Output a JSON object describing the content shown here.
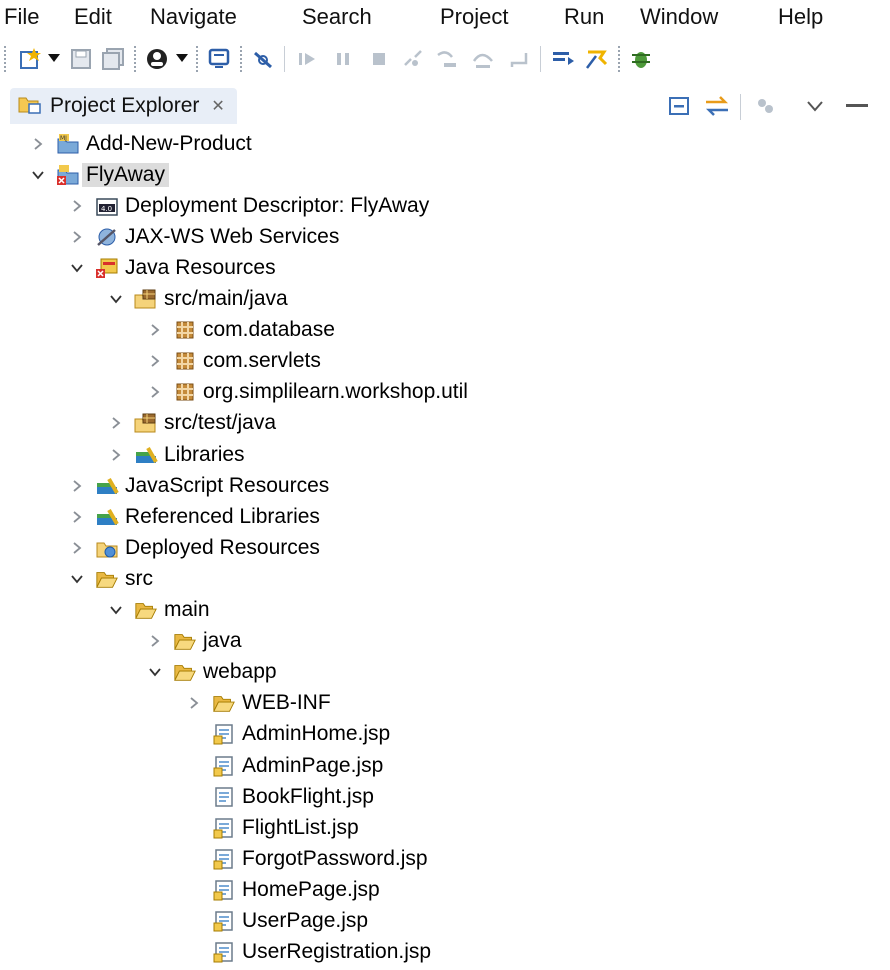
{
  "menu": [
    "File",
    "Edit",
    "Navigate",
    "Search",
    "Project",
    "Run",
    "Window",
    "Help"
  ],
  "explorer": {
    "title": "Project Explorer",
    "close_glyph": "✕"
  },
  "tree": [
    {
      "label": "Add-New-Product",
      "depth": 0,
      "state": "collapsed",
      "icon": "project-icon"
    },
    {
      "label": "FlyAway",
      "depth": 0,
      "state": "expanded",
      "icon": "project-error-icon",
      "selected": true
    },
    {
      "label": "Deployment Descriptor: FlyAway",
      "depth": 1,
      "state": "collapsed",
      "icon": "deployment-descriptor-icon"
    },
    {
      "label": "JAX-WS Web Services",
      "depth": 1,
      "state": "collapsed",
      "icon": "web-services-icon"
    },
    {
      "label": "Java Resources",
      "depth": 1,
      "state": "expanded",
      "icon": "java-resources-error-icon"
    },
    {
      "label": "src/main/java",
      "depth": 2,
      "state": "expanded",
      "icon": "source-folder-icon"
    },
    {
      "label": "com.database",
      "depth": 3,
      "state": "collapsed",
      "icon": "package-icon"
    },
    {
      "label": "com.servlets",
      "depth": 3,
      "state": "collapsed",
      "icon": "package-icon"
    },
    {
      "label": "org.simplilearn.workshop.util",
      "depth": 3,
      "state": "collapsed",
      "icon": "package-icon"
    },
    {
      "label": "src/test/java",
      "depth": 2,
      "state": "collapsed",
      "icon": "source-folder-icon"
    },
    {
      "label": "Libraries",
      "depth": 2,
      "state": "collapsed",
      "icon": "libraries-icon"
    },
    {
      "label": "JavaScript Resources",
      "depth": 1,
      "state": "collapsed",
      "icon": "libraries-icon"
    },
    {
      "label": "Referenced Libraries",
      "depth": 1,
      "state": "collapsed",
      "icon": "libraries-icon"
    },
    {
      "label": "Deployed Resources",
      "depth": 1,
      "state": "collapsed",
      "icon": "deployed-resources-icon"
    },
    {
      "label": "src",
      "depth": 1,
      "state": "expanded",
      "icon": "open-folder-icon"
    },
    {
      "label": "main",
      "depth": 2,
      "state": "expanded",
      "icon": "open-folder-icon"
    },
    {
      "label": "java",
      "depth": 3,
      "state": "collapsed",
      "icon": "folder-icon"
    },
    {
      "label": "webapp",
      "depth": 3,
      "state": "expanded",
      "icon": "open-folder-icon"
    },
    {
      "label": "WEB-INF",
      "depth": 4,
      "state": "collapsed",
      "icon": "folder-icon"
    },
    {
      "label": "AdminHome.jsp",
      "depth": 4,
      "state": "leaf",
      "icon": "jsp-file-icon"
    },
    {
      "label": "AdminPage.jsp",
      "depth": 4,
      "state": "leaf",
      "icon": "jsp-file-icon"
    },
    {
      "label": "BookFlight.jsp",
      "depth": 4,
      "state": "leaf",
      "icon": "jsp-file-plain-icon"
    },
    {
      "label": "FlightList.jsp",
      "depth": 4,
      "state": "leaf",
      "icon": "jsp-file-icon"
    },
    {
      "label": "ForgotPassword.jsp",
      "depth": 4,
      "state": "leaf",
      "icon": "jsp-file-icon"
    },
    {
      "label": "HomePage.jsp",
      "depth": 4,
      "state": "leaf",
      "icon": "jsp-file-icon"
    },
    {
      "label": "UserPage.jsp",
      "depth": 4,
      "state": "leaf",
      "icon": "jsp-file-icon"
    },
    {
      "label": "UserRegistration.jsp",
      "depth": 4,
      "state": "leaf",
      "icon": "jsp-file-icon"
    }
  ]
}
